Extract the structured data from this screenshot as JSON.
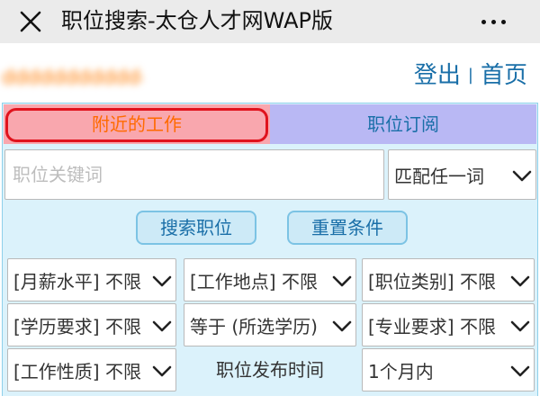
{
  "window": {
    "title": "职位搜索-太仓人才网WAP版"
  },
  "icons": {
    "close": "close-icon",
    "more": "more-dots-icon",
    "chevron": "chevron-down-icon"
  },
  "user": {
    "name": "ddddddddddddd",
    "logout": "登出",
    "separator": "|",
    "home": "首页"
  },
  "tabs": [
    {
      "label": "附近的工作",
      "active": true
    },
    {
      "label": "职位订阅",
      "active": false
    }
  ],
  "search": {
    "keyword_value": "",
    "keyword_placeholder": "职位关键词",
    "match_mode": "匹配任一词"
  },
  "buttons": {
    "search": "搜索职位",
    "reset": "重置条件"
  },
  "filters": {
    "salary": "[月薪水平] 不限",
    "location": "[工作地点] 不限",
    "category": "[职位类别] 不限",
    "education": "[学历要求] 不限",
    "edu_compare": "等于 (所选学历)",
    "major": "[专业要求] 不限",
    "job_type": "[工作性质] 不限",
    "publish_time_label": "职位发布时间",
    "publish_time": "1个月内"
  },
  "colors": {
    "accent": "#1a6fa8",
    "panel_bg": "#dbf2fb",
    "active_tab_bg": "#f9a7ae",
    "active_tab_text": "#ff6a00",
    "inactive_tab_bg": "#b9b8f4",
    "highlight_ring": "#e0131d",
    "username": "#ff7a00"
  }
}
